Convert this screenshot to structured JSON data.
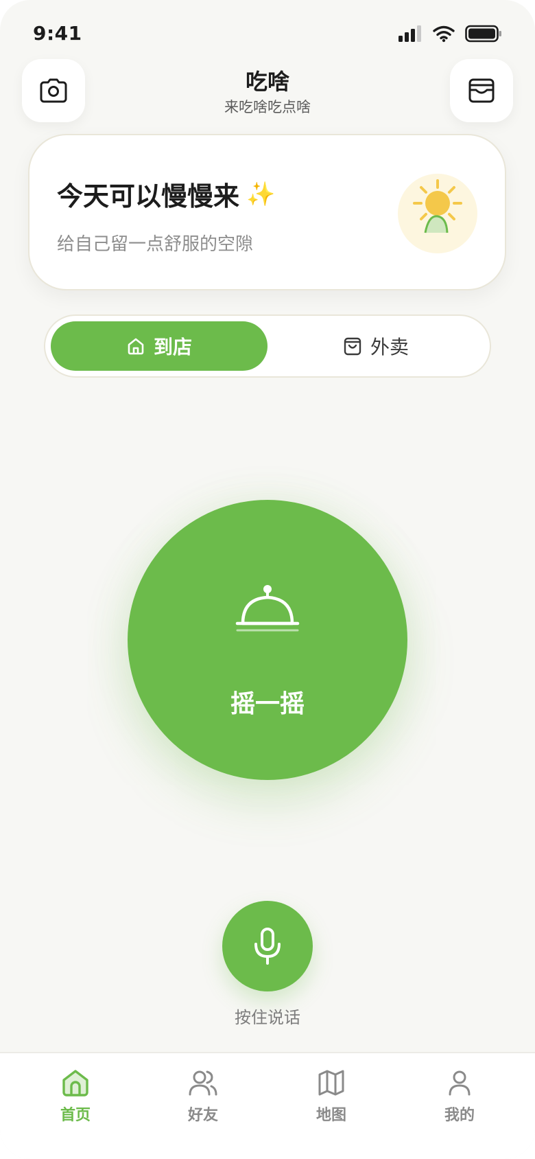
{
  "status_bar": {
    "time": "9:41"
  },
  "header": {
    "title": "吃啥",
    "subtitle": "来吃啥吃点啥",
    "left_icon": "camera-icon",
    "right_icon": "inbox-icon"
  },
  "greeting": {
    "title": "今天可以慢慢来",
    "sparkle": "✨",
    "subtitle": "给自己留一点舒服的空隙",
    "icon": "sun-icon"
  },
  "mode_toggle": {
    "options": [
      {
        "label": "到店",
        "icon": "store-icon",
        "selected": true
      },
      {
        "label": "外卖",
        "icon": "bag-icon",
        "selected": false
      }
    ]
  },
  "shake": {
    "label": "摇一摇",
    "icon": "dish-cloche-icon"
  },
  "voice": {
    "label": "按住说话",
    "icon": "microphone-icon"
  },
  "tabbar": {
    "items": [
      {
        "label": "首页",
        "icon": "home-icon",
        "active": true
      },
      {
        "label": "好友",
        "icon": "friends-icon",
        "active": false
      },
      {
        "label": "地图",
        "icon": "map-icon",
        "active": false
      },
      {
        "label": "我的",
        "icon": "profile-icon",
        "active": false
      }
    ]
  },
  "colors": {
    "accent": "#6cbb4b",
    "background": "#f7f7f4",
    "sun": "#f4c84a"
  }
}
